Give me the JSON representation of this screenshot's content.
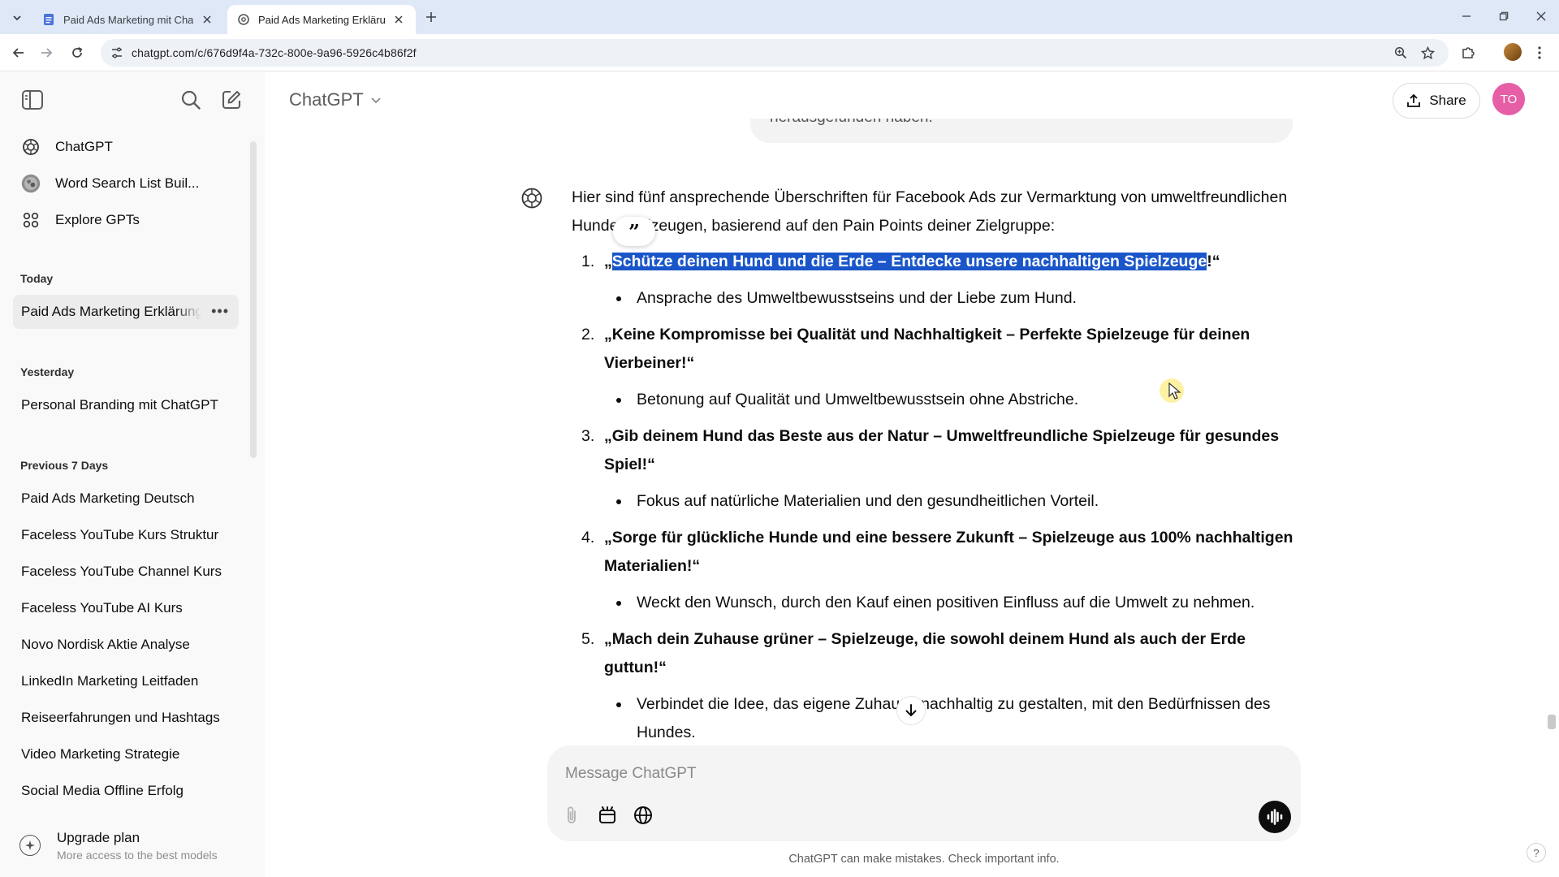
{
  "browser": {
    "tabs": [
      {
        "title": "Paid Ads Marketing mit ChatGPT",
        "active": false
      },
      {
        "title": "Paid Ads Marketing Erklärung",
        "active": true
      }
    ],
    "url": "chatgpt.com/c/676d9f4a-732c-800e-9a96-5926c4b86f2f"
  },
  "sidebar": {
    "nav": [
      {
        "label": "ChatGPT",
        "icon": "openai-logo-icon"
      },
      {
        "label": "Word Search List Buil...",
        "icon": "gpt-avatar-icon"
      },
      {
        "label": "Explore GPTs",
        "icon": "grid-icon"
      }
    ],
    "sections": [
      {
        "label": "Today",
        "items": [
          "Paid Ads Marketing Erklärung"
        ]
      },
      {
        "label": "Yesterday",
        "items": [
          "Personal Branding mit ChatGPT"
        ]
      },
      {
        "label": "Previous 7 Days",
        "items": [
          "Paid Ads Marketing Deutsch",
          "Faceless YouTube Kurs Struktur",
          "Faceless YouTube Channel Kurs",
          "Faceless YouTube AI Kurs",
          "Novo Nordisk Aktie Analyse",
          "LinkedIn Marketing Leitfaden",
          "Reiseerfahrungen und Hashtags",
          "Video Marketing Strategie",
          "Social Media Offline Erfolg"
        ]
      }
    ],
    "upgrade": {
      "title": "Upgrade plan",
      "subtitle": "More access to the best models"
    }
  },
  "header": {
    "model": "ChatGPT",
    "share_label": "Share",
    "avatar_initials": "TO"
  },
  "conversation": {
    "user_tail_text": "herausgefunden haben.",
    "intro": "Hier sind fünf ansprechende Überschriften für Facebook Ads zur Vermarktung von umweltfreundlichen Hundespielzeugen, basierend auf den Pain Points deiner Zielgruppe:",
    "items": [
      {
        "num": "1.",
        "open_quote": "„",
        "selected": "Schütze deinen Hund und die Erde – Entdecke unsere nachhaltigen Spielzeuge",
        "close": "!“",
        "bullet": "Ansprache des Umweltbewusstseins und der Liebe zum Hund."
      },
      {
        "num": "2.",
        "headline": "„Keine Kompromisse bei Qualität und Nachhaltigkeit – Perfekte Spielzeuge für deinen Vierbeiner!“",
        "bullet": "Betonung auf Qualität und Umweltbewusstsein ohne Abstriche."
      },
      {
        "num": "3.",
        "headline": "„Gib deinem Hund das Beste aus der Natur – Umweltfreundliche Spielzeuge für gesundes Spiel!“",
        "bullet": "Fokus auf natürliche Materialien und den gesundheitlichen Vorteil."
      },
      {
        "num": "4.",
        "headline": "„Sorge für glückliche Hunde und eine bessere Zukunft – Spielzeuge aus 100% nachhaltigen Materialien!“",
        "bullet": "Weckt den Wunsch, durch den Kauf einen positiven Einfluss auf die Umwelt zu nehmen."
      },
      {
        "num": "5.",
        "headline": "„Mach dein Zuhause grüner – Spielzeuge, die sowohl deinem Hund als auch der Erde guttun!“",
        "bullet": "Verbindet die Idee, das eigene Zuhause nachhaltig zu gestalten, mit den Bedürfnissen des Hundes."
      }
    ]
  },
  "composer": {
    "placeholder": "Message ChatGPT",
    "disclaimer": "ChatGPT can make mistakes. Check important info.",
    "help": "?"
  },
  "colors": {
    "selection": "#1a56c9",
    "avatar": "#e65ea6",
    "sidebar_bg": "#f9f9f9",
    "tabbar_bg": "#dfe8f7"
  }
}
